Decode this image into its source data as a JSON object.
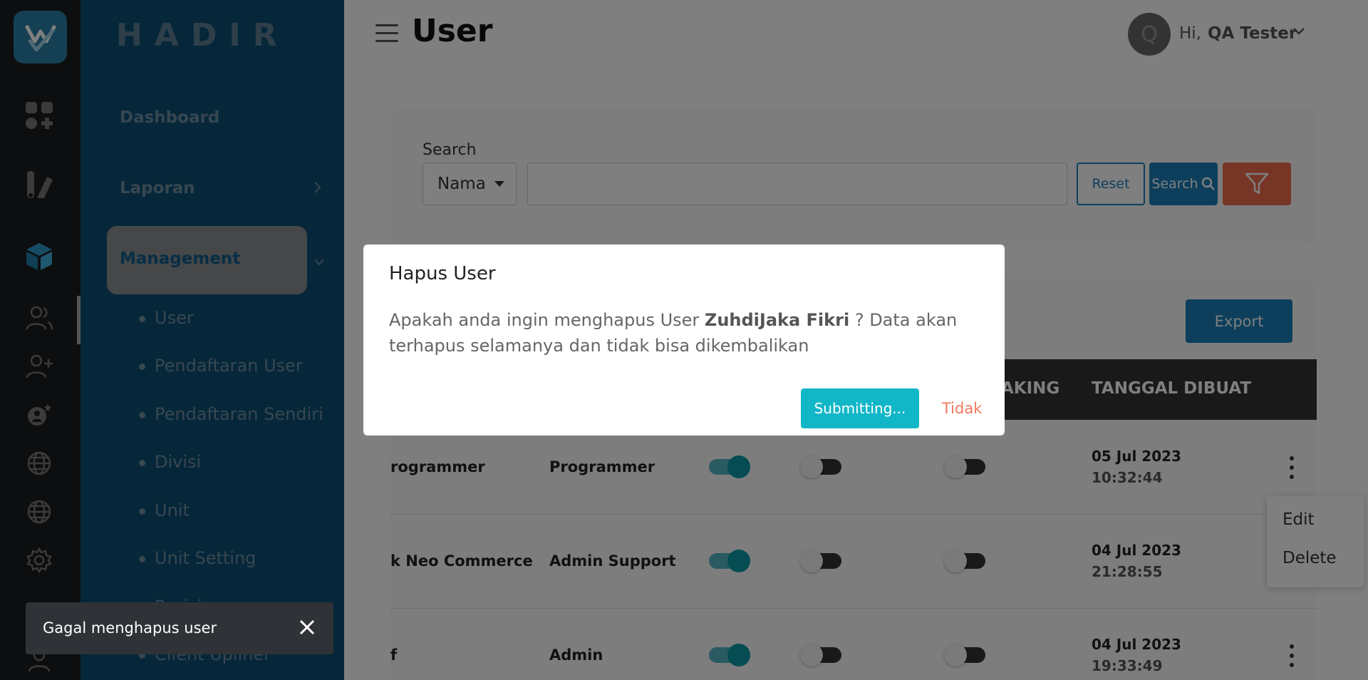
{
  "brand": {
    "name": "HADIR"
  },
  "sidebar": {
    "items": [
      {
        "label": "Dashboard"
      },
      {
        "label": "Laporan"
      },
      {
        "label": "Management"
      }
    ],
    "sub_items": [
      {
        "label": "User"
      },
      {
        "label": "Pendaftaran User"
      },
      {
        "label": "Pendaftaran Sendiri"
      },
      {
        "label": "Divisi"
      },
      {
        "label": "Unit"
      },
      {
        "label": "Unit Setting"
      },
      {
        "label": "Posisi"
      },
      {
        "label": "Client Upliner"
      }
    ]
  },
  "rail_icons": [
    "app-icon",
    "dashboard-add-icon",
    "report-icon",
    "cube-icon",
    "users-icon",
    "user-add-icon",
    "user-star-icon",
    "globe-icon",
    "globe-icon",
    "settings-icon",
    "gear-icon",
    "user-icon"
  ],
  "header": {
    "title": "User",
    "greeting": "Hi,",
    "user_name": "QA Tester",
    "avatar_initial": "Q"
  },
  "search": {
    "label": "Search",
    "select_value": "Nama",
    "input_value": "",
    "reset_label": "Reset",
    "search_label": "Search"
  },
  "table": {
    "export_label": "Export",
    "headers": [
      "AKING",
      "TANGGAL DIBUAT"
    ],
    "rows": [
      {
        "col1": "rogrammer",
        "col2": "Programmer",
        "toggle1": true,
        "toggle2": false,
        "toggle3": false,
        "date": "05 Jul 2023",
        "time": "10:32:44"
      },
      {
        "col1": "k Neo Commerce",
        "col2": "Admin Support",
        "toggle1": true,
        "toggle2": false,
        "toggle3": false,
        "date": "04 Jul 2023",
        "time": "21:28:55"
      },
      {
        "col1": "f",
        "col2": "Admin",
        "toggle1": true,
        "toggle2": false,
        "toggle3": false,
        "date": "04 Jul 2023",
        "time": "19:33:49"
      }
    ]
  },
  "row_menu": {
    "edit_label": "Edit",
    "delete_label": "Delete"
  },
  "modal": {
    "title": "Hapus User",
    "body_prefix": "Apakah anda ingin menghapus User",
    "user_name": "ZuhdiJaka Fikri",
    "body_suffix": "? Data akan terhapus selamanya dan tidak bisa dikembalikan",
    "submit_label": "Submitting...",
    "cancel_label": "Tidak"
  },
  "toast": {
    "message": "Gagal menghapus user"
  },
  "colors": {
    "primary": "#1a7fb8",
    "danger": "#ef6b4d",
    "teal": "#12b7c7",
    "sidebar": "#0d4e75",
    "rail": "#1b1c1e"
  }
}
